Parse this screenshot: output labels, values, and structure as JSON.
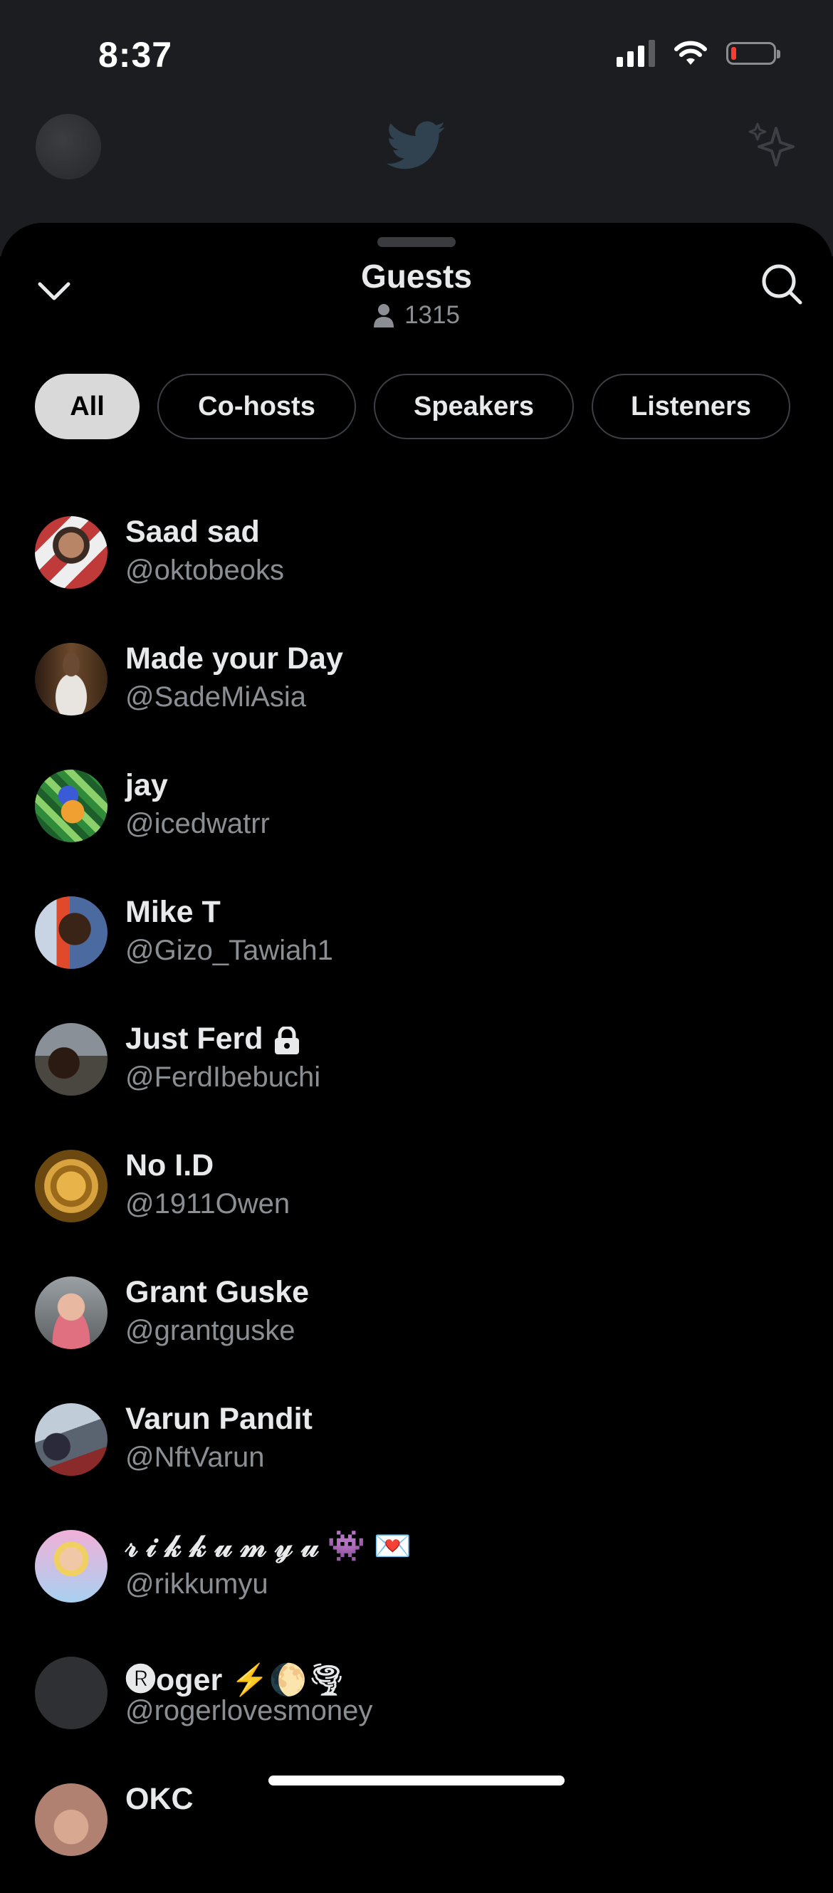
{
  "status": {
    "time": "8:37"
  },
  "sheet": {
    "title": "Guests",
    "count": "1315",
    "tabs": [
      "All",
      "Co-hosts",
      "Speakers",
      "Listeners"
    ],
    "active_tab": "All"
  },
  "guests": [
    {
      "name": "Saad sad",
      "handle": "@oktobeoks"
    },
    {
      "name": "Made your Day",
      "handle": "@SadeMiAsia"
    },
    {
      "name": "jay",
      "handle": "@icedwatrr"
    },
    {
      "name": "Mike T",
      "handle": "@Gizo_Tawiah1"
    },
    {
      "name": "Just Ferd",
      "handle": "@FerdIbebuchi"
    },
    {
      "name": "No I.D",
      "handle": "@1911Owen"
    },
    {
      "name": "Grant Guske",
      "handle": "@grantguske"
    },
    {
      "name": "Varun Pandit",
      "handle": "@NftVarun"
    },
    {
      "name": "𝓇 𝒾 𝓀 𝓀 𝓊 𝓂 𝓎 𝓊 👾 💌",
      "handle": "@rikkumyu"
    },
    {
      "name": "🅡oger ⚡🌔🌪",
      "handle": "@rogerlovesmoney"
    },
    {
      "name": "OKC",
      "handle": ""
    }
  ],
  "colors": {
    "background": "#000000",
    "secondary_text": "#8b8f94",
    "active_tab": "#d9d9d9"
  },
  "icons": [
    "chevron-down-icon",
    "search-icon",
    "person-icon",
    "lock-icon",
    "twitter-bird-icon",
    "sparkle-icon"
  ]
}
